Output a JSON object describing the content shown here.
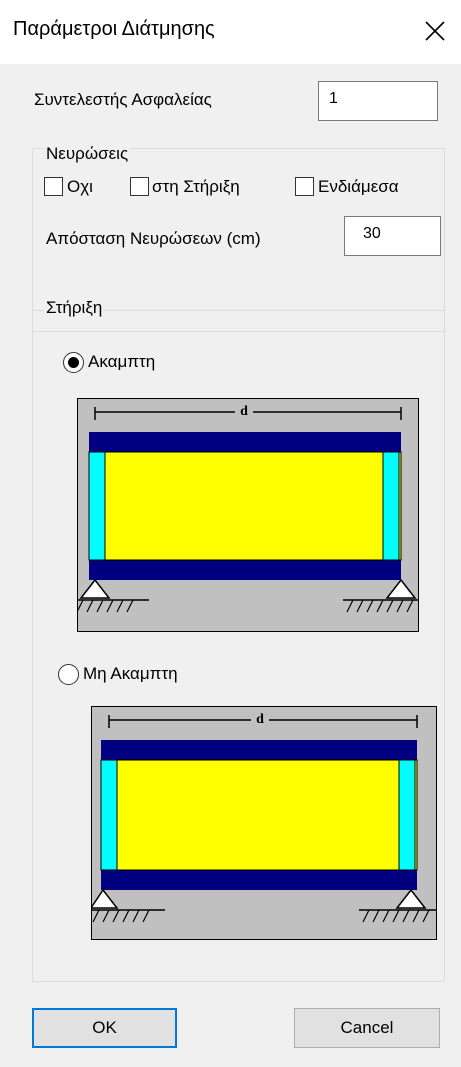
{
  "window": {
    "title": "Παράμετροι Διάτμησης",
    "close_glyph": "✕"
  },
  "safety": {
    "label": "Συντελεστής Ασφαλείας",
    "value": "1"
  },
  "ribs": {
    "group_title": "Νευρώσεις",
    "options": [
      {
        "label": "Οχι",
        "checked": false
      },
      {
        "label": "στη Στήριξη",
        "checked": false
      },
      {
        "label": "Ενδιάμεσα",
        "checked": false
      }
    ],
    "distance_label": "Απόσταση Νευρώσεων (cm)",
    "distance_value": "30"
  },
  "support": {
    "group_title": "Στήριξη",
    "options": [
      {
        "label": "Ακαμπτη",
        "selected": true
      },
      {
        "label": "Μη Ακαμπτη",
        "selected": false
      }
    ],
    "dimension_label": "d"
  },
  "buttons": {
    "ok": "OK",
    "cancel": "Cancel"
  },
  "colors": {
    "flange": "#000080",
    "web": "#ffff00",
    "stiffener": "#00ffff",
    "diagram_bg": "#c0c0c0",
    "default_button_border": "#0078d7"
  }
}
